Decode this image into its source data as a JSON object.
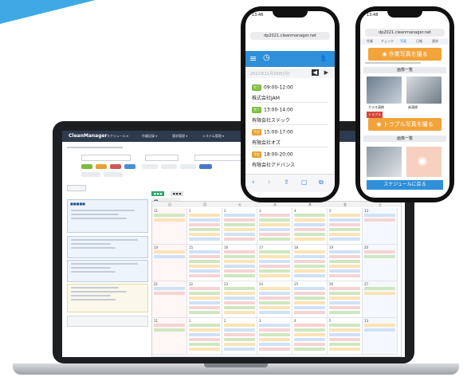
{
  "laptop_app": {
    "brand": "CleanManager",
    "menu": [
      "スケジュール ▾",
      "作業記録 ▾",
      "請求管理 ▾",
      "システム管理 ▾"
    ],
    "week_days": [
      "日",
      "月",
      "火",
      "水",
      "木",
      "金",
      "土"
    ],
    "day_numbers": [
      "11",
      "1",
      "2",
      "3",
      "4",
      "5",
      "13",
      "14",
      "15",
      "16",
      "17",
      "18",
      "19",
      "20",
      "21",
      "22",
      "23",
      "24",
      "25",
      "26",
      "27"
    ]
  },
  "phone_left": {
    "time": "13:46",
    "address": "dp2021.cleanmanager.net",
    "date_header": "2021年11月29日(月)",
    "entries": [
      {
        "badge": "完了",
        "time": "09:00-12:00",
        "company": "株式会社JAM"
      },
      {
        "badge": "完了",
        "time": "13:00-14:00",
        "company": "有限会社ステック"
      },
      {
        "badge": "予定",
        "time": "15:00-17:00",
        "company": "有限会社オズ"
      },
      {
        "badge": "予定",
        "time": "18:00-20:00",
        "company": "有限会社アドバンス"
      }
    ]
  },
  "phone_right": {
    "time": "13:48",
    "address": "dp2021.cleanmanager.net",
    "tabs": [
      "作業",
      "チェック",
      "写真",
      "日報",
      "請求"
    ],
    "photo_button": "作業写真を撮る",
    "list_label": "画像一覧",
    "photo_captions": [
      "ガラス清掃",
      "床清掃"
    ],
    "trouble_tag": "トラブル",
    "trouble_button": "トラブル写真を撮る",
    "footer_button": "スケジュールに戻る"
  },
  "colors": {
    "accent_blue": "#2f8fd8",
    "orange": "#f2a33a",
    "badge_done": "#7cbb3c",
    "badge_plan": "#e6a230"
  }
}
